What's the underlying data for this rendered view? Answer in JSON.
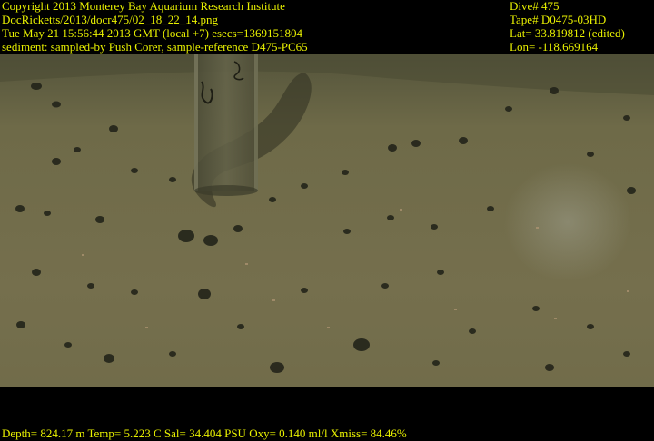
{
  "overlay": {
    "top_left": [
      "Copyright 2013 Monterey Bay Aquarium Research Institute",
      "DocRicketts/2013/docr475/02_18_22_14.png",
      "Tue May 21 15:56:44 2013 GMT (local +7)  esecs=1369151804",
      "sediment: sampled-by Push Corer, sample-reference D475-PC65"
    ],
    "top_right": [
      "Dive# 475",
      "Tape# D0475-03HD",
      "Lat= 33.819812 (edited)",
      "Lon= -118.669164"
    ],
    "bottom": "Depth= 824.17 m  Temp= 5.223 C  Sal= 34.404 PSU  Oxy= 0.140 ml/l  Xmiss= 84.46%",
    "text_color": "#e8f000"
  },
  "scene": {
    "seafloor_color": "#6f6a47",
    "shadow_color": "#2f3021"
  }
}
